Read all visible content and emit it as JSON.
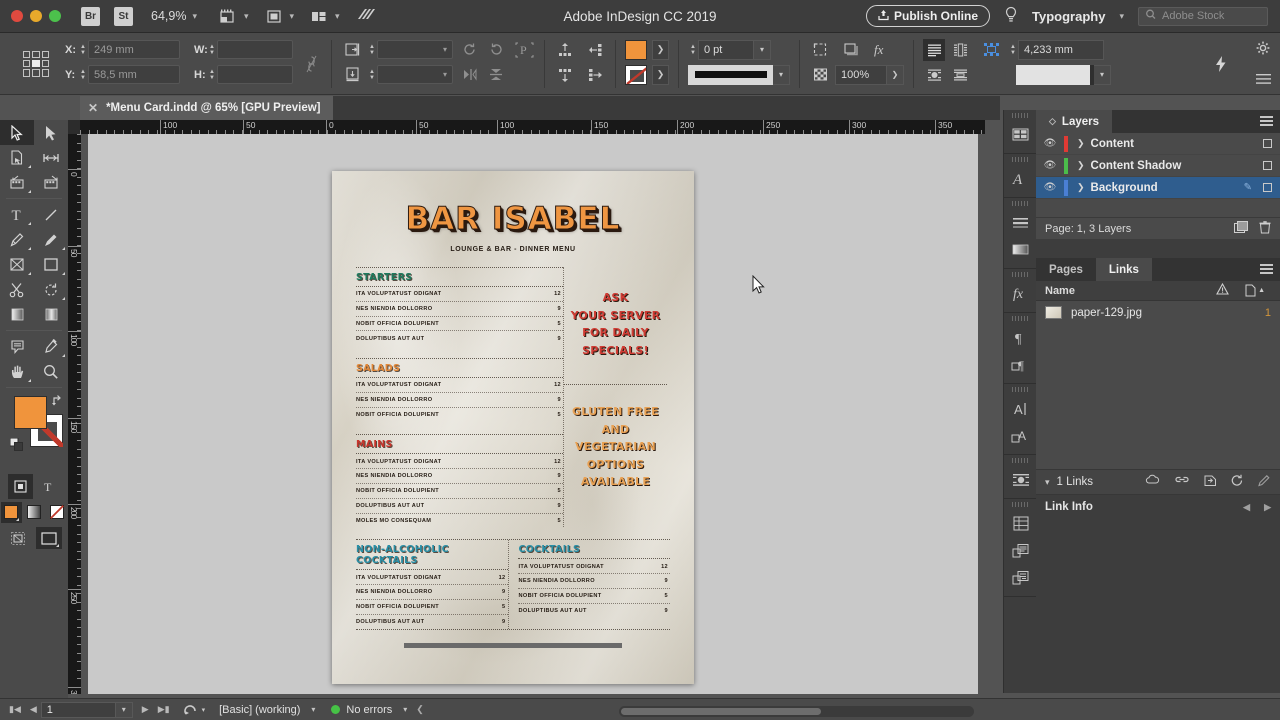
{
  "titlebar": {
    "bridge_label": "Br",
    "stock_label": "St",
    "zoom_level": "64,9%",
    "app_title": "Adobe InDesign CC 2019",
    "publish_label": "Publish Online",
    "workspace": "Typography",
    "search_placeholder": "Adobe Stock"
  },
  "control_bar": {
    "x_label": "X:",
    "x_value": "249 mm",
    "y_label": "Y:",
    "y_value": "58,5 mm",
    "w_label": "W:",
    "w_value": "",
    "h_label": "H:",
    "h_value": "",
    "rotate_value": "",
    "shear_value": "",
    "stroke_weight": "0 pt",
    "opacity": "100%",
    "text_frame_inset": "4,233 mm",
    "fill_color": "#f0943c"
  },
  "document_tab": {
    "close_label": "✕",
    "title": "*Menu Card.indd @ 65% [GPU Preview]"
  },
  "rulers": {
    "horizontal": [
      "100",
      "50",
      "0",
      "50",
      "100",
      "150",
      "200",
      "250",
      "300",
      "350"
    ],
    "vertical": [
      "0",
      "50",
      "100",
      "150",
      "200",
      "250",
      "3"
    ]
  },
  "document": {
    "title": "BAR ISABEL",
    "subtitle": "LOUNGE & BAR - DINNER MENU",
    "sections": [
      {
        "name": "STARTERS",
        "color": "#1f7a5e",
        "items": [
          {
            "name": "ITA VOLUPTATUST ODIGNAT",
            "price": "12"
          },
          {
            "name": "NES NIENDIA DOLLORRO",
            "price": "9"
          },
          {
            "name": "NOBIT OFFICIA DOLUPIENT",
            "price": "5"
          },
          {
            "name": "DOLUPTIBUS AUT AUT",
            "price": "9"
          }
        ]
      },
      {
        "name": "SALADS",
        "color": "#e2893a",
        "items": [
          {
            "name": "ITA VOLUPTATUST ODIGNAT",
            "price": "12"
          },
          {
            "name": "NES NIENDIA DOLLORRO",
            "price": "9"
          },
          {
            "name": "NOBIT OFFICIA DOLUPIENT",
            "price": "5"
          }
        ]
      },
      {
        "name": "MAINS",
        "color": "#c8352c",
        "items": [
          {
            "name": "ITA VOLUPTATUST ODIGNAT",
            "price": "12"
          },
          {
            "name": "NES NIENDIA DOLLORRO",
            "price": "9"
          },
          {
            "name": "NOBIT OFFICIA DOLUPIENT",
            "price": "5"
          },
          {
            "name": "DOLUPTIBUS AUT AUT",
            "price": "9"
          },
          {
            "name": "MOLES MO CONSEQUAM",
            "price": "5"
          }
        ]
      }
    ],
    "callout_one": "ASK\nYOUR SERVER\nFOR DAILY\nSPECIALS!",
    "callout_two": "GLUTEN FREE\nAND\nVEGETARIAN\nOPTIONS\nAVAILABLE",
    "cocktail_sections": [
      {
        "name": "NON-ALCOHOLIC COCKTAILS",
        "color": "#2a8fa6",
        "items": [
          {
            "name": "ITA VOLUPTATUST ODIGNAT",
            "price": "12"
          },
          {
            "name": "NES NIENDIA DOLLORRO",
            "price": "9"
          },
          {
            "name": "NOBIT OFFICIA DOLUPIENT",
            "price": "5"
          },
          {
            "name": "DOLUPTIBUS AUT AUT",
            "price": "9"
          }
        ]
      },
      {
        "name": "COCKTAILS",
        "color": "#2a8fa6",
        "items": [
          {
            "name": "ITA VOLUPTATUST ODIGNAT",
            "price": "12"
          },
          {
            "name": "NES NIENDIA DOLLORRO",
            "price": "9"
          },
          {
            "name": "NOBIT OFFICIA DOLUPIENT",
            "price": "5"
          },
          {
            "name": "DOLUPTIBUS AUT AUT",
            "price": "9"
          }
        ]
      }
    ]
  },
  "layers_panel": {
    "tab_label": "Layers",
    "rows": [
      {
        "name": "Content",
        "color": "#e03a34"
      },
      {
        "name": "Content Shadow",
        "color": "#4bbd4b"
      },
      {
        "name": "Background",
        "color": "#4a7fd4"
      }
    ],
    "footer": "Page: 1, 3 Layers"
  },
  "links_panel": {
    "tabs": [
      "Pages",
      "Links"
    ],
    "active_tab": "Links",
    "column_name": "Name",
    "rows": [
      {
        "name": "paper-129.jpg",
        "page": "1"
      }
    ],
    "count_label": "1 Links",
    "info_label": "Link Info"
  },
  "status_bar": {
    "page_value": "1",
    "preflight_profile": "[Basic] (working)",
    "errors": "No errors"
  }
}
